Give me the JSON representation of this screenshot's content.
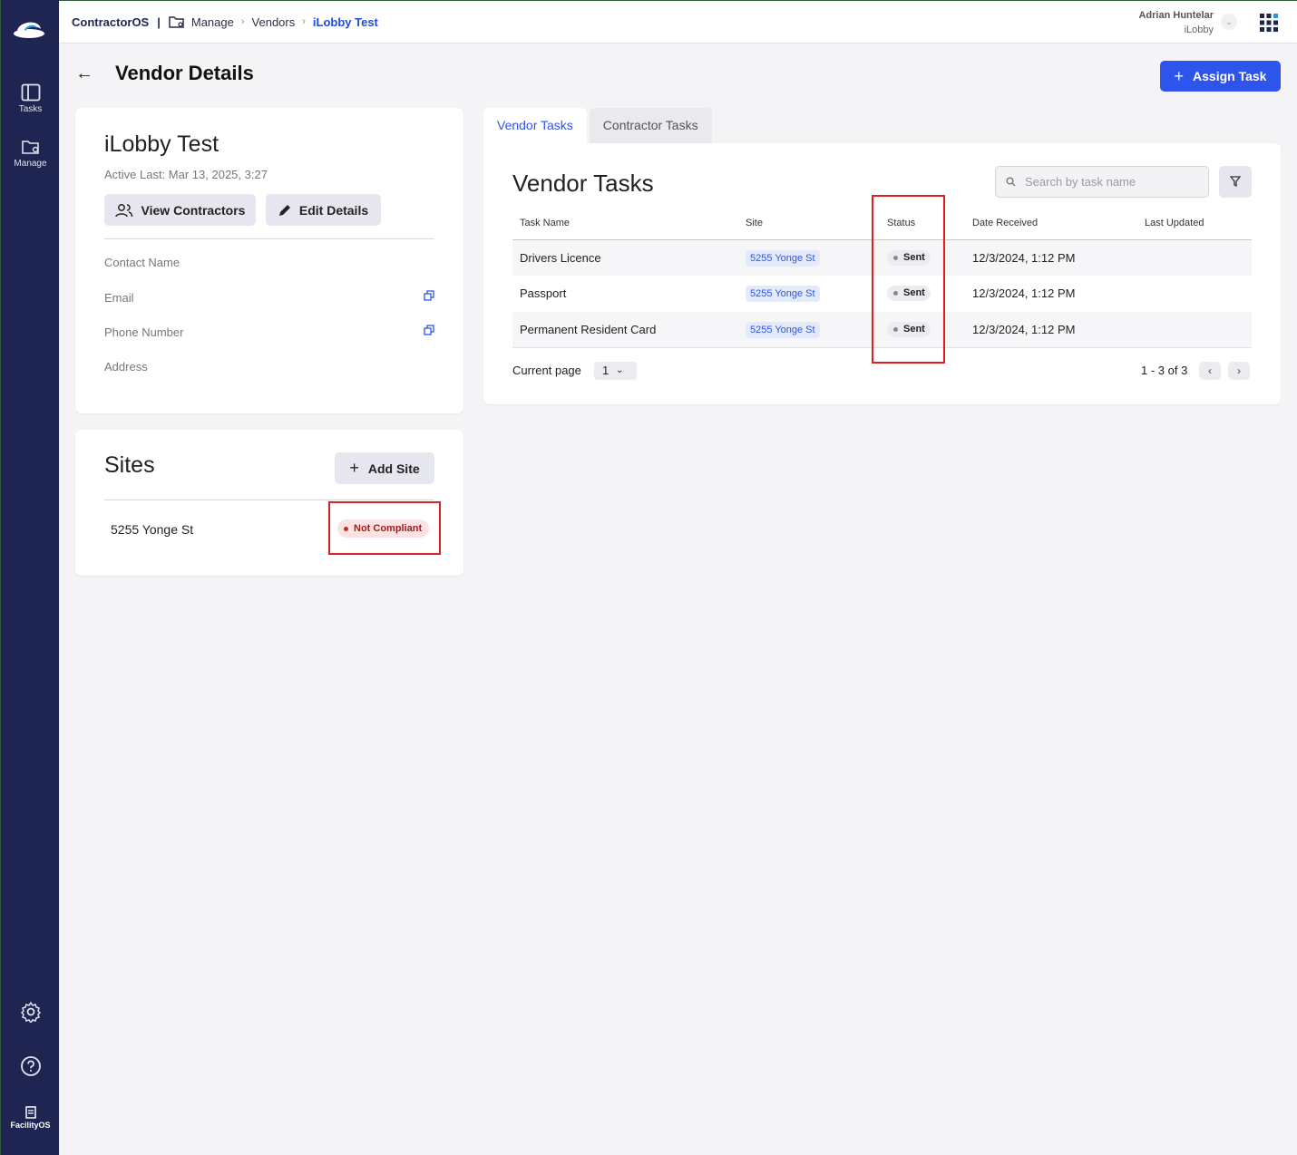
{
  "sidebar": {
    "items": [
      {
        "label": "Tasks",
        "icon": "panel-icon"
      },
      {
        "label": "Manage",
        "icon": "folder-gear-icon"
      }
    ],
    "bottom": {
      "settings_icon": "gear-icon",
      "help_icon": "help-icon",
      "brand_label": "FacilityOS"
    }
  },
  "topbar": {
    "app_name": "ContractorOS",
    "breadcrumb": [
      "Manage",
      "Vendors",
      "iLobby Test"
    ],
    "user_name": "Adrian Huntelar",
    "user_org": "iLobby"
  },
  "page": {
    "title": "Vendor Details",
    "assign_button": "Assign Task"
  },
  "vendor": {
    "name": "iLobby Test",
    "active_last": "Active Last: Mar 13, 2025, 3:27",
    "view_contractors": "View Contractors",
    "edit_details": "Edit Details",
    "fields": {
      "contact_name": "Contact Name",
      "email": "Email",
      "phone": "Phone Number",
      "address": "Address"
    }
  },
  "sites": {
    "title": "Sites",
    "add_button": "Add Site",
    "items": [
      {
        "name": "5255 Yonge St",
        "status": "Not Compliant"
      }
    ]
  },
  "tabs": [
    {
      "label": "Vendor Tasks",
      "active": true
    },
    {
      "label": "Contractor Tasks",
      "active": false
    }
  ],
  "tasks": {
    "title": "Vendor Tasks",
    "search_placeholder": "Search by task name",
    "columns": [
      "Task Name",
      "Site",
      "Status",
      "Date Received",
      "Last Updated"
    ],
    "rows": [
      {
        "task": "Drivers Licence",
        "site": "5255 Yonge St",
        "status": "Sent",
        "received": "12/3/2024, 1:12 PM",
        "updated": ""
      },
      {
        "task": "Passport",
        "site": "5255 Yonge St",
        "status": "Sent",
        "received": "12/3/2024, 1:12 PM",
        "updated": ""
      },
      {
        "task": "Permanent Resident Card",
        "site": "5255 Yonge St",
        "status": "Sent",
        "received": "12/3/2024, 1:12 PM",
        "updated": ""
      }
    ],
    "pager": {
      "label": "Current page",
      "page": "1",
      "range": "1 - 3 of 3"
    }
  },
  "colors": {
    "sidebar": "#1e2551",
    "accent": "#2f54eb",
    "highlight_box": "#e02020"
  }
}
